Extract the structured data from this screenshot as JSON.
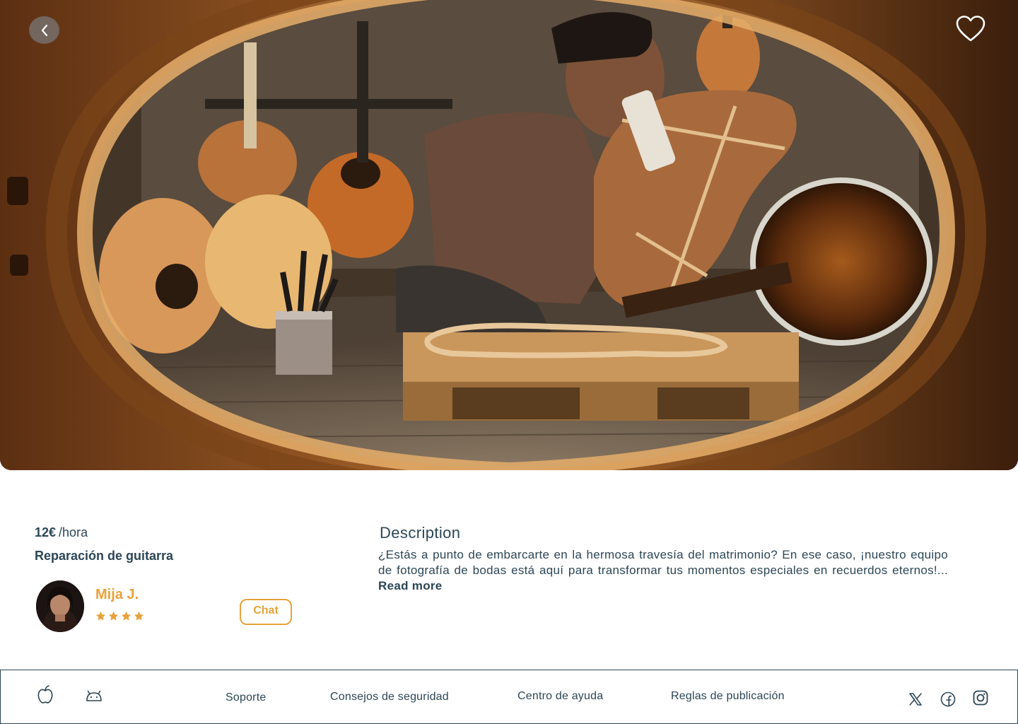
{
  "hero": {
    "image_alt": "Artesano reparando una guitarra en un taller",
    "icons": {
      "back": "chevron-left-icon",
      "favorite": "heart-icon"
    }
  },
  "listing": {
    "price_amount": "12€",
    "price_unit": "/hora",
    "title": "Reparación de guitarra",
    "provider": {
      "name": "Mija J.",
      "rating": 4,
      "rating_max": 4
    },
    "chat_label": "Chat"
  },
  "description": {
    "title": "Description",
    "text": "¿Estás a punto de embarcarte en la hermosa travesía del matrimonio? En ese caso, ¡nuestro equipo de fotografía de bodas está aquí para transformar tus momentos especiales en recuerdos eternos!... ",
    "read_more": "Read more"
  },
  "footer": {
    "app_icons": [
      "apple-icon",
      "android-icon"
    ],
    "links": [
      "Soporte",
      "Consejos de seguridad",
      "Centro de ayuda",
      "Reglas de publicación"
    ],
    "social_icons": [
      "x-icon",
      "facebook-icon",
      "instagram-icon"
    ]
  },
  "colors": {
    "accent": "#e8a13b",
    "text": "#2c4656",
    "border": "#2c4656"
  }
}
